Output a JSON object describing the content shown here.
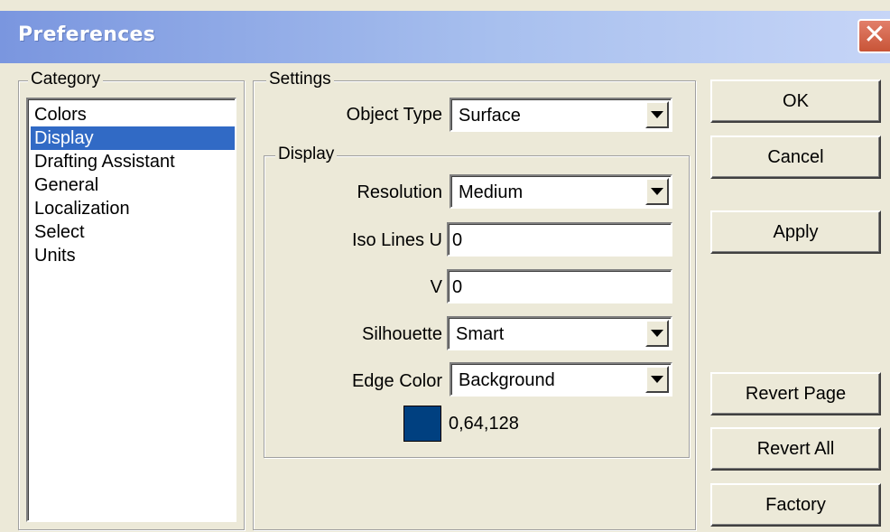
{
  "window": {
    "title": "Preferences",
    "close_glyph": "✕"
  },
  "category": {
    "label": "Category",
    "items": [
      {
        "label": "Colors",
        "selected": false
      },
      {
        "label": "Display",
        "selected": true
      },
      {
        "label": "Drafting Assistant",
        "selected": false
      },
      {
        "label": "General",
        "selected": false
      },
      {
        "label": "Localization",
        "selected": false
      },
      {
        "label": "Select",
        "selected": false
      },
      {
        "label": "Units",
        "selected": false
      }
    ]
  },
  "settings": {
    "label": "Settings",
    "object_type": {
      "label": "Object Type",
      "value": "Surface"
    },
    "display": {
      "label": "Display",
      "resolution": {
        "label": "Resolution",
        "value": "Medium"
      },
      "iso_lines_u": {
        "label": "Iso Lines U",
        "value": "0"
      },
      "v": {
        "label": "V",
        "value": "0"
      },
      "silhouette": {
        "label": "Silhouette",
        "value": "Smart"
      },
      "edge_color": {
        "label": "Edge Color",
        "value": "Background",
        "swatch_color": "#004080",
        "rgb_text": "0,64,128"
      }
    }
  },
  "buttons": {
    "ok": "OK",
    "cancel": "Cancel",
    "apply": "Apply",
    "revert_page": "Revert Page",
    "revert_all": "Revert All",
    "factory": "Factory"
  },
  "colors": {
    "selection": "#316ac5",
    "dialog_bg": "#ece9d8",
    "close_button": "#c85437"
  }
}
